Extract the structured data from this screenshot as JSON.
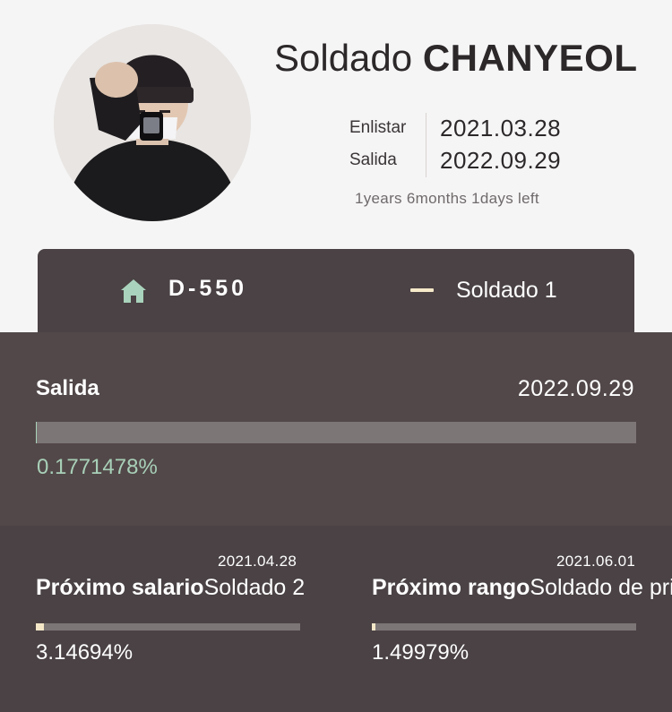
{
  "profile": {
    "rank": "Soldado",
    "name": "CHANYEOL",
    "enlist_label": "Enlistar",
    "enlist_date": "2021.03.28",
    "discharge_label": "Salida",
    "discharge_date": "2022.09.29",
    "remaining": "1years 6months 1days left"
  },
  "status": {
    "home_icon": "home-icon",
    "dday": "D-550",
    "rank_icon": "rank-bar-icon",
    "current_rank": "Soldado 1",
    "accent_color": "#a9d3bc"
  },
  "discharge": {
    "label": "Salida",
    "date": "2022.09.29",
    "progress_percent": 0.1771478,
    "progress_text": "0.1771478%"
  },
  "next_salary": {
    "date": "2021.04.28",
    "label": "Próximo salario",
    "value": "Soldado 2",
    "progress_percent": 3.14694,
    "progress_text": "3.14694%"
  },
  "next_rank": {
    "date": "2021.06.01",
    "label": "Próximo rango",
    "value": "Soldado de primera",
    "progress_percent": 1.49979,
    "progress_text": "1.49979%"
  }
}
